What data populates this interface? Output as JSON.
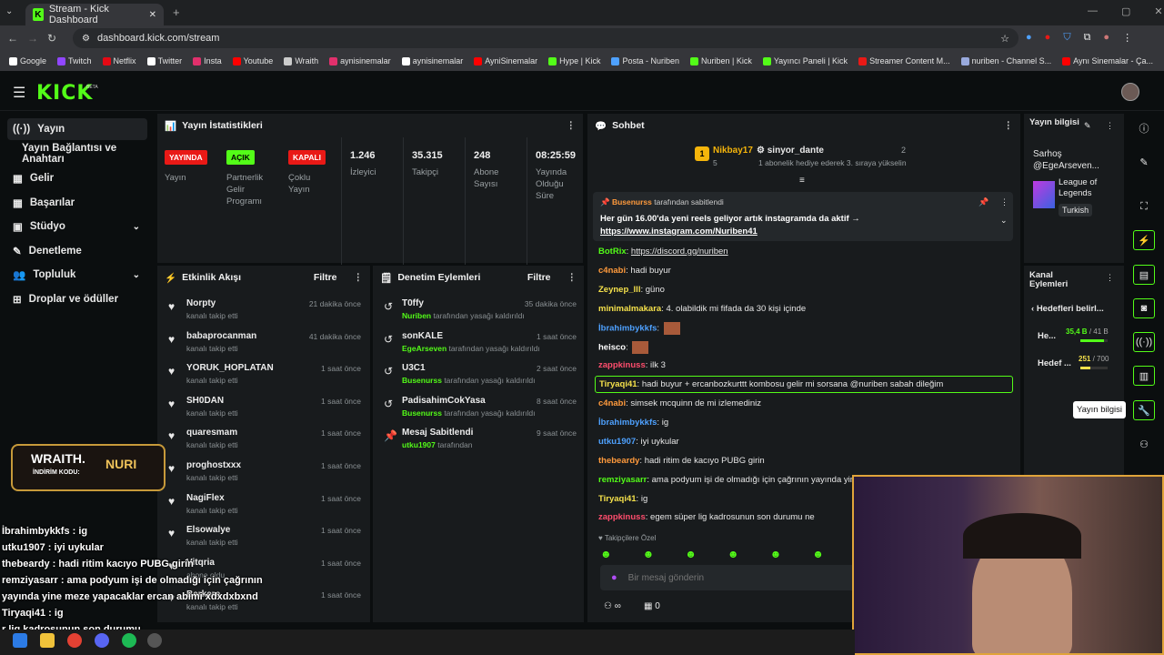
{
  "browser": {
    "tab_title": "Stream - Kick Dashboard",
    "url": "dashboard.kick.com/stream",
    "bookmarks": [
      "Google",
      "Twitch",
      "Netflix",
      "Twitter",
      "Insta",
      "Youtube",
      "Wraith",
      "aynisinemalar",
      "aynisinemalar",
      "AyniSinemalar",
      "Hype | Kick",
      "Posta - Nuriben",
      "Nuriben | Kick",
      "Yayıncı Paneli | Kick",
      "Streamer Content M...",
      "nuriben - Channel S...",
      "Aynı Sinemalar - Ça..."
    ]
  },
  "brand": {
    "logo": "KICK",
    "beta": "BETA"
  },
  "sidebar": {
    "items": [
      {
        "label": "Yayın",
        "icon": "stream-icon"
      },
      {
        "label": "Yayın Bağlantısı ve Anahtarı",
        "icon": ""
      },
      {
        "label": "Gelir",
        "icon": "revenue-icon"
      },
      {
        "label": "Başarılar",
        "icon": "achievements-icon"
      },
      {
        "label": "Stüdyo",
        "icon": "studio-icon"
      },
      {
        "label": "Denetleme",
        "icon": "moderation-icon"
      },
      {
        "label": "Topluluk",
        "icon": "community-icon"
      },
      {
        "label": "Droplar ve ödüller",
        "icon": "drops-icon"
      }
    ]
  },
  "stats": {
    "title": "Yayın İstatistikleri",
    "items": [
      {
        "value": "YAYINDA",
        "label": "Yayın"
      },
      {
        "value": "AÇIK",
        "label": "Partnerlik Gelir Programı"
      },
      {
        "value": "KAPALI",
        "label": "Çoklu Yayın"
      },
      {
        "value": "1.246",
        "label": "İzleyici"
      },
      {
        "value": "35.315",
        "label": "Takipçi"
      },
      {
        "value": "248",
        "label": "Abone Sayısı"
      },
      {
        "value": "08:25:59",
        "label": "Yayında Olduğu Süre"
      }
    ]
  },
  "activity": {
    "title": "Etkinlik Akışı",
    "filter": "Filtre",
    "items": [
      {
        "name": "Norpty",
        "sub": "kanalı takip etti",
        "time": "21 dakika önce"
      },
      {
        "name": "babaprocanman",
        "sub": "kanalı takip etti",
        "time": "41 dakika önce"
      },
      {
        "name": "YORUK_HOPLATAN",
        "sub": "kanalı takip etti",
        "time": "1 saat önce"
      },
      {
        "name": "SH0DAN",
        "sub": "kanalı takip etti",
        "time": "1 saat önce"
      },
      {
        "name": "quaresmam",
        "sub": "kanalı takip etti",
        "time": "1 saat önce"
      },
      {
        "name": "proghostxxx",
        "sub": "kanalı takip etti",
        "time": "1 saat önce"
      },
      {
        "name": "NagiFlex",
        "sub": "kanalı takip etti",
        "time": "1 saat önce"
      },
      {
        "name": "Elsowalye",
        "sub": "kanalı takip etti",
        "time": "1 saat önce"
      },
      {
        "name": "Vitqria",
        "sub": "abone oldu",
        "time": "1 saat önce"
      },
      {
        "name": "Berkere",
        "sub": "kanalı takip etti",
        "time": "1 saat önce"
      }
    ]
  },
  "mod": {
    "title": "Denetim Eylemleri",
    "filter": "Filtre",
    "items": [
      {
        "name": "T0ffy",
        "by": "Nuriben",
        "sub": "tarafından yasağı kaldırıldı",
        "time": "35 dakika önce"
      },
      {
        "name": "sonKALE",
        "by": "EgeArseven",
        "sub": "tarafından yasağı kaldırıldı",
        "time": "1 saat önce"
      },
      {
        "name": "U3C1",
        "by": "Busenurss",
        "sub": "tarafından yasağı kaldırıldı",
        "time": "2 saat önce"
      },
      {
        "name": "PadisahimCokYasa",
        "by": "Busenurss",
        "sub": "tarafından yasağı kaldırıldı",
        "time": "8 saat önce"
      },
      {
        "name": "Mesaj Sabitlendi",
        "by": "utku1907",
        "sub": "tarafından",
        "time": "9 saat önce"
      }
    ]
  },
  "chat": {
    "title": "Sohbet",
    "gift": {
      "user1": "Nikbay17",
      "user1_count": "5",
      "user2": "sinyor_dante",
      "user2_count": "2",
      "note": "1 abonelik hediye ederek 3. sıraya yükselin"
    },
    "pinned": {
      "by": "Busenurss",
      "by_suffix": "tarafından sabitlendi",
      "text": "Her gün 16.00'da yeni reels geliyor artık instagramda da aktif →",
      "link": "https://www.instagram.com/Nuriben41"
    },
    "messages": [
      {
        "user": "BotRix",
        "color": "#53fc18",
        "text": "https://discord.gg/nuriben"
      },
      {
        "user": "c4nabi",
        "color": "#ff9a3c",
        "text": "hadi buyur"
      },
      {
        "user": "Zeynep_lll",
        "color": "#f5e14b",
        "text": "güno"
      },
      {
        "user": "minimalmakara",
        "color": "#f5e14b",
        "text": "4. olabildik mi fifada da 30 kişi içinde"
      },
      {
        "user": "İbrahimbykkfs",
        "color": "#4ea1ff",
        "text": ""
      },
      {
        "user": "heisco",
        "color": "#ffffff",
        "text": ""
      },
      {
        "user": "zappkinuss",
        "color": "#ff4d6d",
        "text": "ilk 3"
      },
      {
        "user": "Tiryaqi41",
        "color": "#f5e14b",
        "text": "hadi buyur + ercanbozkurttt kombosu gelir mi sorsana @nuriben sabah dileğim"
      },
      {
        "user": "c4nabi",
        "color": "#ff9a3c",
        "text": "simsek mcquinn de mi izlemediniz"
      },
      {
        "user": "İbrahimbykkfs",
        "color": "#4ea1ff",
        "text": "ig"
      },
      {
        "user": "utku1907",
        "color": "#4ea1ff",
        "text": "iyi uykular"
      },
      {
        "user": "thebeardy",
        "color": "#ff9a3c",
        "text": "hadi ritim de kacıyo PUBG girin"
      },
      {
        "user": "remziyasarr",
        "color": "#53fc18",
        "text": "ama podyum işi de olmadığı için çağrının yayında yine"
      },
      {
        "user": "Tiryaqi41",
        "color": "#f5e14b",
        "text": "ig"
      },
      {
        "user": "zappkinuss",
        "color": "#ff4d6d",
        "text": "egem süper lig kadrosunun son durumu ne"
      }
    ],
    "followers_only": "Takipçilere Özel",
    "input_placeholder": "Bir mesaj gönderin",
    "points": "0"
  },
  "info": {
    "title": "Yayın bilgisi",
    "stream_title": "Sarhoş @EgeArseven...",
    "category": "League of Legends",
    "language": "Turkish",
    "tooltip": "Yayın bilgisi"
  },
  "channel": {
    "title": "Kanal Eylemleri",
    "goals_label": "Hedefleri belirl...",
    "goal1": {
      "label": "He...",
      "value": "35,4 B",
      "target": "/ 41 B",
      "ratio": 0.86
    },
    "goal2": {
      "label": "Hedef ...",
      "value": "251",
      "target": "/ 700",
      "ratio": 0.36
    }
  },
  "overlay": {
    "promo_brand": "WRAITH.",
    "promo_code": "NURI",
    "promo_label": "İNDİRİM KODU:",
    "chat": [
      "İbrahimbykkfs : ig",
      "utku1907 : iyi uykular",
      "thebeardy : hadi ritim kacıyo PUBG girin",
      "remziyasarr : ama podyum işi de olmadığı için çağrının",
      "yayında yine meze yapacaklar ercan abimi xdxdxbxnd",
      "Tiryaqi41 : ig",
      "r lig kadrosunun son durumu"
    ]
  },
  "colors": {
    "accent": "#53fc18",
    "bg": "#0b0e0f",
    "panel": "#181b1d",
    "red": "#e91916"
  }
}
